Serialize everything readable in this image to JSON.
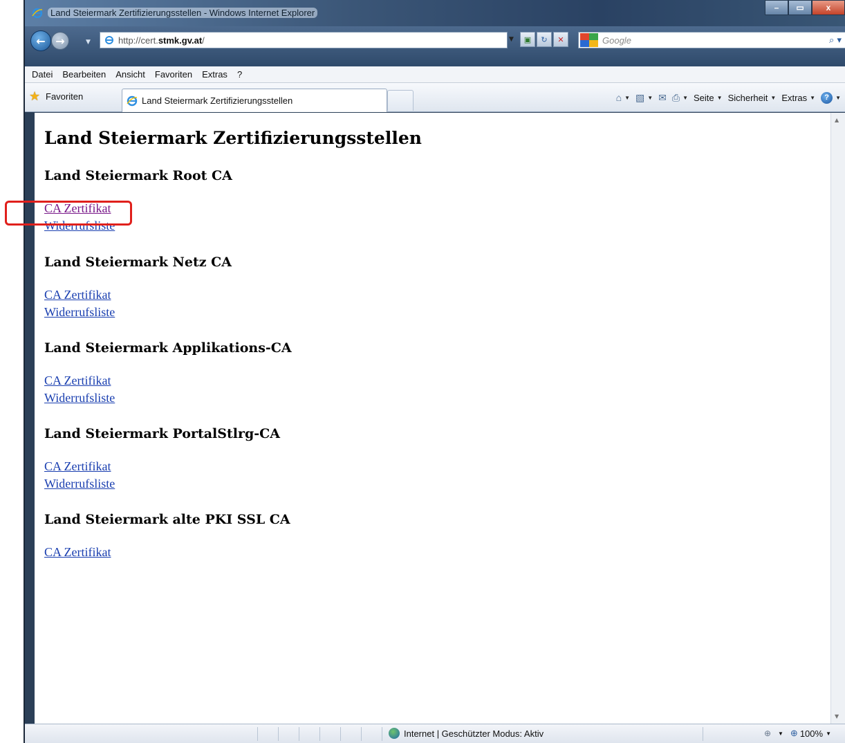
{
  "window": {
    "title": "Land Steiermark Zertifizierungsstellen - Windows Internet Explorer",
    "minimize": "–",
    "maximize": "▭",
    "close": "x"
  },
  "address_bar": {
    "url_prefix": "http://cert.",
    "url_host": "stmk.gv.at",
    "url_suffix": "/",
    "search_placeholder": "Google"
  },
  "menu": {
    "items": [
      "Datei",
      "Bearbeiten",
      "Ansicht",
      "Favoriten",
      "Extras",
      "?"
    ]
  },
  "favorites_bar": {
    "favorites_label": "Favoriten",
    "tab_label": "Land Steiermark Zertifizierungsstellen",
    "commands": {
      "page": "Seite",
      "security": "Sicherheit",
      "tools": "Extras"
    }
  },
  "content": {
    "page_title": "Land Steiermark Zertifizierungsstellen",
    "sections": [
      {
        "heading": "Land Steiermark Root CA",
        "links": [
          "CA Zertifikat",
          "Widerrufsliste"
        ]
      },
      {
        "heading": "Land Steiermark Netz CA",
        "links": [
          "CA Zertifikat",
          "Widerrufsliste"
        ]
      },
      {
        "heading": "Land Steiermark Applikations-CA",
        "links": [
          "CA Zertifikat",
          "Widerrufsliste"
        ]
      },
      {
        "heading": "Land Steiermark PortalStlrg-CA",
        "links": [
          "CA Zertifikat",
          "Widerrufsliste"
        ]
      },
      {
        "heading": "Land Steiermark alte PKI SSL CA",
        "links": [
          "CA Zertifikat"
        ]
      }
    ]
  },
  "status_bar": {
    "zone_text": "Internet | Geschützter Modus: Aktiv",
    "zoom": "100%"
  },
  "colors": {
    "link": "#1a3fb0",
    "visited_link": "#7a1a8a",
    "highlight_box": "#e0201c"
  }
}
